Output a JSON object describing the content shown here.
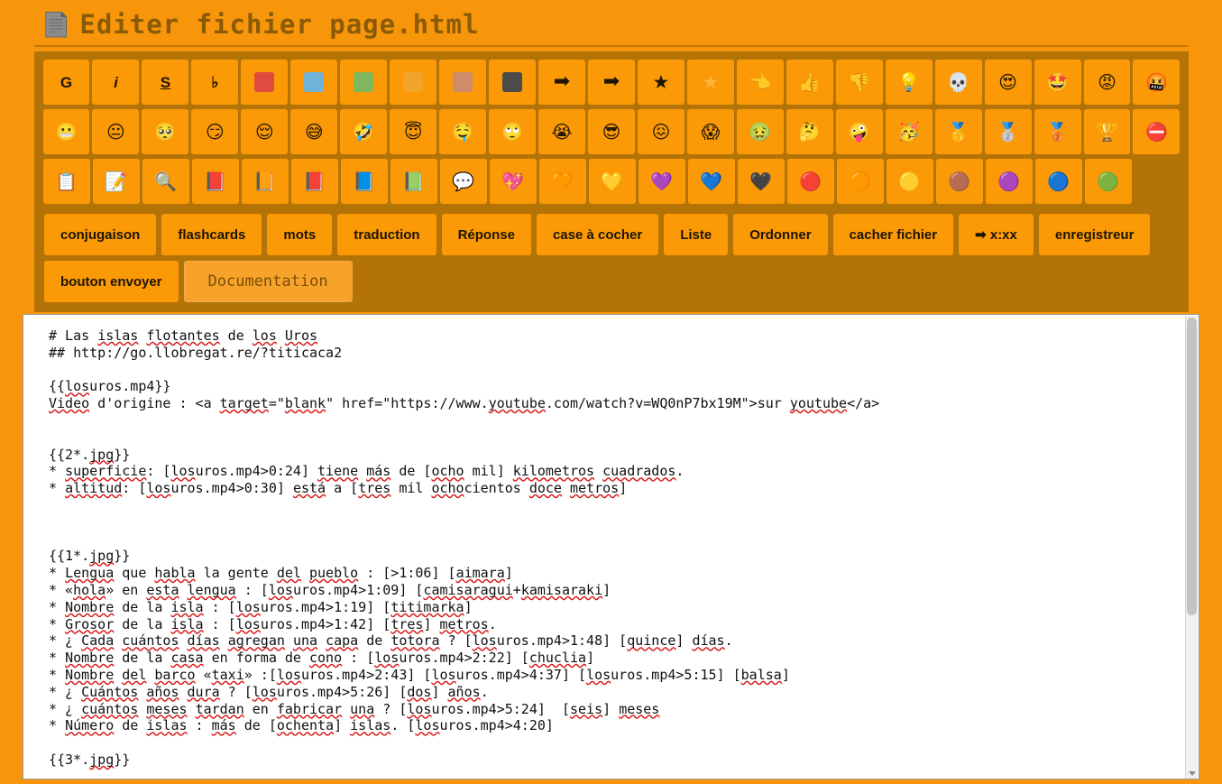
{
  "window": {
    "title": "Editer fichier page.html",
    "title_icon": "document-icon"
  },
  "toolbar": {
    "format_row": [
      {
        "name": "bold-button",
        "label": "G",
        "kind": "text"
      },
      {
        "name": "italic-button",
        "label": "i",
        "kind": "text"
      },
      {
        "name": "underline-button",
        "label": "S",
        "kind": "text"
      },
      {
        "name": "music-note-button",
        "label": "♭",
        "kind": "text"
      },
      {
        "name": "color-red-button",
        "kind": "swatch",
        "color": "#e04a3f"
      },
      {
        "name": "color-blue-button",
        "kind": "swatch",
        "color": "#6fb3d8"
      },
      {
        "name": "color-green-button",
        "kind": "swatch",
        "color": "#7fb85c"
      },
      {
        "name": "color-pale-button",
        "kind": "swatch",
        "color": "#f0a42c"
      },
      {
        "name": "color-salmon-button",
        "kind": "swatch",
        "color": "#d08a6c"
      },
      {
        "name": "color-dark-button",
        "kind": "swatch",
        "color": "#4b4b47"
      },
      {
        "name": "arrow-right-button",
        "kind": "glyph",
        "label": "➡",
        "style": "arrow"
      },
      {
        "name": "arrow-right-alt-button",
        "kind": "glyph",
        "label": "➡",
        "style": "arrow"
      },
      {
        "name": "star-button",
        "kind": "glyph",
        "label": "★",
        "style": "star"
      },
      {
        "name": "star-light-button",
        "kind": "glyph",
        "label": "★",
        "style": "star-light"
      },
      {
        "name": "pointing-hand-button",
        "kind": "emoji",
        "label": "👈"
      },
      {
        "name": "thumbs-up-button",
        "kind": "emoji",
        "label": "👍"
      },
      {
        "name": "thumbs-down-button",
        "kind": "emoji",
        "label": "👎"
      },
      {
        "name": "light-bulb-button",
        "kind": "emoji",
        "label": "💡"
      },
      {
        "name": "skull-button",
        "kind": "emoji",
        "label": "💀"
      },
      {
        "name": "heart-eyes-button",
        "kind": "emoji",
        "label": "😍"
      },
      {
        "name": "star-struck-button",
        "kind": "emoji",
        "label": "🤩"
      },
      {
        "name": "angry-face-button",
        "kind": "emoji",
        "label": "😡"
      },
      {
        "name": "cursing-face-button",
        "kind": "emoji",
        "label": "🤬"
      }
    ],
    "emoji_row": [
      {
        "name": "grimacing-face-button",
        "label": "😬"
      },
      {
        "name": "neutral-face-button",
        "label": "😐"
      },
      {
        "name": "pleading-face-button",
        "label": "🥺"
      },
      {
        "name": "smirking-face-button",
        "label": "😏"
      },
      {
        "name": "relieved-face-button",
        "label": "😌"
      },
      {
        "name": "sweat-smile-button",
        "label": "😅"
      },
      {
        "name": "rolling-laugh-button",
        "label": "🤣"
      },
      {
        "name": "halo-face-button",
        "label": "😇"
      },
      {
        "name": "drooling-face-button",
        "label": "🤤"
      },
      {
        "name": "eye-roll-face-button",
        "label": "🙄"
      },
      {
        "name": "loudly-crying-button",
        "label": "😭"
      },
      {
        "name": "sunglasses-face-button",
        "label": "😎"
      },
      {
        "name": "confounded-face-button",
        "label": "😖"
      },
      {
        "name": "screaming-face-button",
        "label": "😱"
      },
      {
        "name": "nauseated-face-button",
        "label": "🤢"
      },
      {
        "name": "thinking-face-button",
        "label": "🤔"
      },
      {
        "name": "zany-face-button",
        "label": "🤪"
      },
      {
        "name": "partying-face-button",
        "label": "🥳"
      },
      {
        "name": "gold-medal-button",
        "label": "🥇"
      },
      {
        "name": "silver-medal-button",
        "label": "🥈"
      },
      {
        "name": "bronze-medal-button",
        "label": "🥉"
      },
      {
        "name": "trophy-button",
        "label": "🏆"
      },
      {
        "name": "no-entry-button",
        "label": "⛔"
      }
    ],
    "object_row": [
      {
        "name": "clipboard-button",
        "label": "📋"
      },
      {
        "name": "memo-button",
        "label": "📝"
      },
      {
        "name": "magnifier-button",
        "label": "🔍"
      },
      {
        "name": "closed-book-button",
        "label": "📕"
      },
      {
        "name": "orange-book-button",
        "label": "📙"
      },
      {
        "name": "red-book-button",
        "label": "📕"
      },
      {
        "name": "blue-book-button",
        "label": "📘"
      },
      {
        "name": "green-book-button",
        "label": "📗"
      },
      {
        "name": "speech-balloon-button",
        "label": "💬"
      },
      {
        "name": "sparkling-heart-button",
        "label": "💖"
      },
      {
        "name": "orange-heart-button",
        "label": "🧡"
      },
      {
        "name": "yellow-heart-button",
        "label": "💛"
      },
      {
        "name": "purple-heart-button",
        "label": "💜"
      },
      {
        "name": "blue-heart-button",
        "label": "💙"
      },
      {
        "name": "black-heart-button",
        "label": "🖤"
      },
      {
        "name": "red-circle-button",
        "label": "🔴"
      },
      {
        "name": "orange-circle-button",
        "label": "🟠"
      },
      {
        "name": "yellow-circle-button",
        "label": "🟡"
      },
      {
        "name": "brown-circle-button",
        "label": "🟤"
      },
      {
        "name": "purple-circle-button",
        "label": "🟣"
      },
      {
        "name": "blue-circle-button",
        "label": "🔵"
      },
      {
        "name": "green-circle-button",
        "label": "🟢"
      }
    ],
    "action_buttons": [
      {
        "name": "conjugaison-button",
        "label": "conjugaison"
      },
      {
        "name": "flashcards-button",
        "label": "flashcards"
      },
      {
        "name": "mots-button",
        "label": "mots"
      },
      {
        "name": "traduction-button",
        "label": "traduction"
      },
      {
        "name": "reponse-button",
        "label": "Réponse"
      },
      {
        "name": "case-a-cocher-button",
        "label": "case à cocher"
      },
      {
        "name": "liste-button",
        "label": "Liste"
      },
      {
        "name": "ordonner-button",
        "label": "Ordonner"
      },
      {
        "name": "cacher-fichier-button",
        "label": "cacher fichier"
      },
      {
        "name": "timecode-button",
        "label": "➡ x:xx"
      },
      {
        "name": "enregistreur-button",
        "label": "enregistreur"
      },
      {
        "name": "bouton-envoyer-button",
        "label": "bouton envoyer"
      }
    ],
    "documentation_button": {
      "name": "documentation-button",
      "label": "Documentation"
    }
  },
  "editor": {
    "content": "# Las islas flotantes de los Uros\n## http://go.llobregat.re/?titicaca2\n\n{{losuros.mp4}}\nVideo d'origine : <a target=\"blank\" href=\"https://www.youtube.com/watch?v=WQ0nP7bx19M\">sur youtube</a>\n\n\n{{2*.jpg}}\n* superficie: [losuros.mp4>0:24] tiene más de [ocho mil] kilometros cuadrados.\n* altitud: [losuros.mp4>0:30] está a [tres mil ochocientos doce metros]\n\n\n\n{{1*.jpg}}\n* Lengua que habla la gente del pueblo : [>1:06] [aimara]\n* «hola» en esta lengua : [losuros.mp4>1:09] [camisaragui+kamisaraki]\n* Nombre de la isla : [losuros.mp4>1:19] [titimarka]\n* Grosor de la isla : [losuros.mp4>1:42] [tres] metros.\n* ¿ Cada cuántos días agregan una capa de totora ? [losuros.mp4>1:48] [quince] días.\n* Nombre de la casa en forma de cono : [losuros.mp4>2:22] [chuclia]\n* Nombre del barco «taxi» :[losuros.mp4>2:43] [losuros.mp4>4:37] [losuros.mp4>5:15] [balsa]\n* ¿ Cuántos años dura ? [losuros.mp4>5:26] [dos] años.\n* ¿ cuántos meses tardan en fabricar una ? [losuros.mp4>5:24]  [seis] meses\n* Número de islas : más de [ochenta] islas. [losuros.mp4>4:20]\n\n{{3*.jpg}}"
  },
  "colors": {
    "page_background": "#f7960a",
    "toolbar_panel": "#b37306",
    "button_face": "#fb9a06",
    "title_text": "#8a5a06",
    "editor_background": "#ffffff"
  }
}
